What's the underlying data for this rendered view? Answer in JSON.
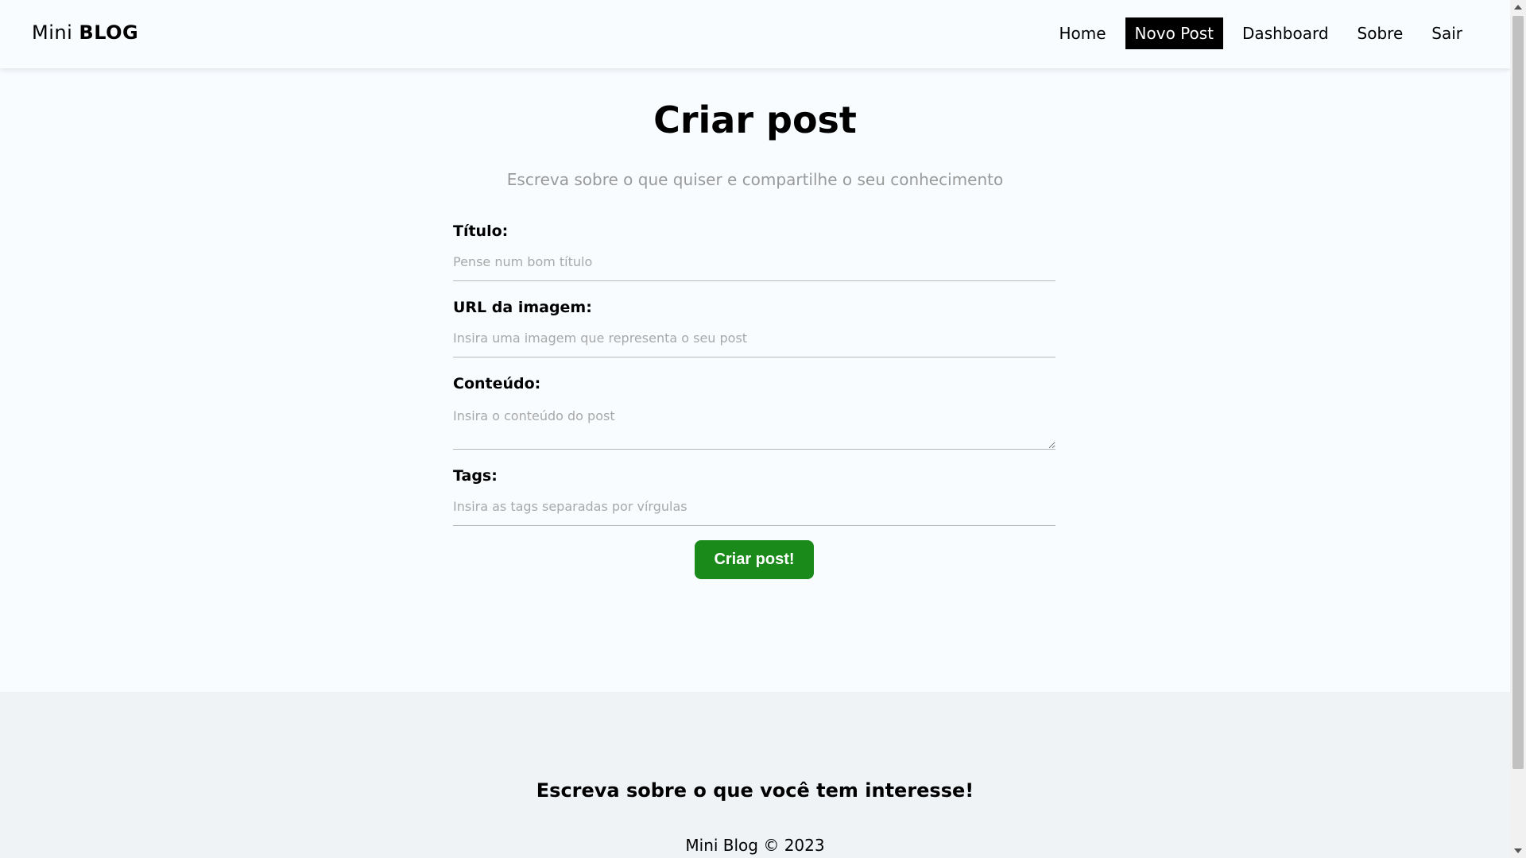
{
  "header": {
    "brand_light": "Mini",
    "brand_bold": "BLOG",
    "nav": [
      {
        "label": "Home"
      },
      {
        "label": "Novo Post"
      },
      {
        "label": "Dashboard"
      },
      {
        "label": "Sobre"
      },
      {
        "label": "Sair"
      }
    ],
    "active_nav": "Novo Post"
  },
  "main": {
    "title": "Criar post",
    "subtitle": "Escreva sobre o que quiser e compartilhe o seu conhecimento",
    "form": {
      "title_label": "Título:",
      "title_placeholder": "Pense num bom título",
      "title_value": "",
      "image_label": "URL da imagem:",
      "image_placeholder": "Insira uma imagem que representa o seu post",
      "image_value": "",
      "content_label": "Conteúdo:",
      "content_placeholder": "Insira o conteúdo do post",
      "content_value": "",
      "tags_label": "Tags:",
      "tags_placeholder": "Insira as tags separadas por vírgulas",
      "tags_value": "",
      "submit_label": "Criar post!"
    }
  },
  "footer": {
    "heading": "Escreva sobre o que você tem interesse!",
    "copyright": "Mini Blog © 2023"
  },
  "colors": {
    "page_background": "#f8fcff",
    "footer_background": "#eff3f6",
    "active_nav_background": "#000000",
    "submit_button": "#1a8a1a",
    "subtitle_text": "#9a9a9a"
  }
}
